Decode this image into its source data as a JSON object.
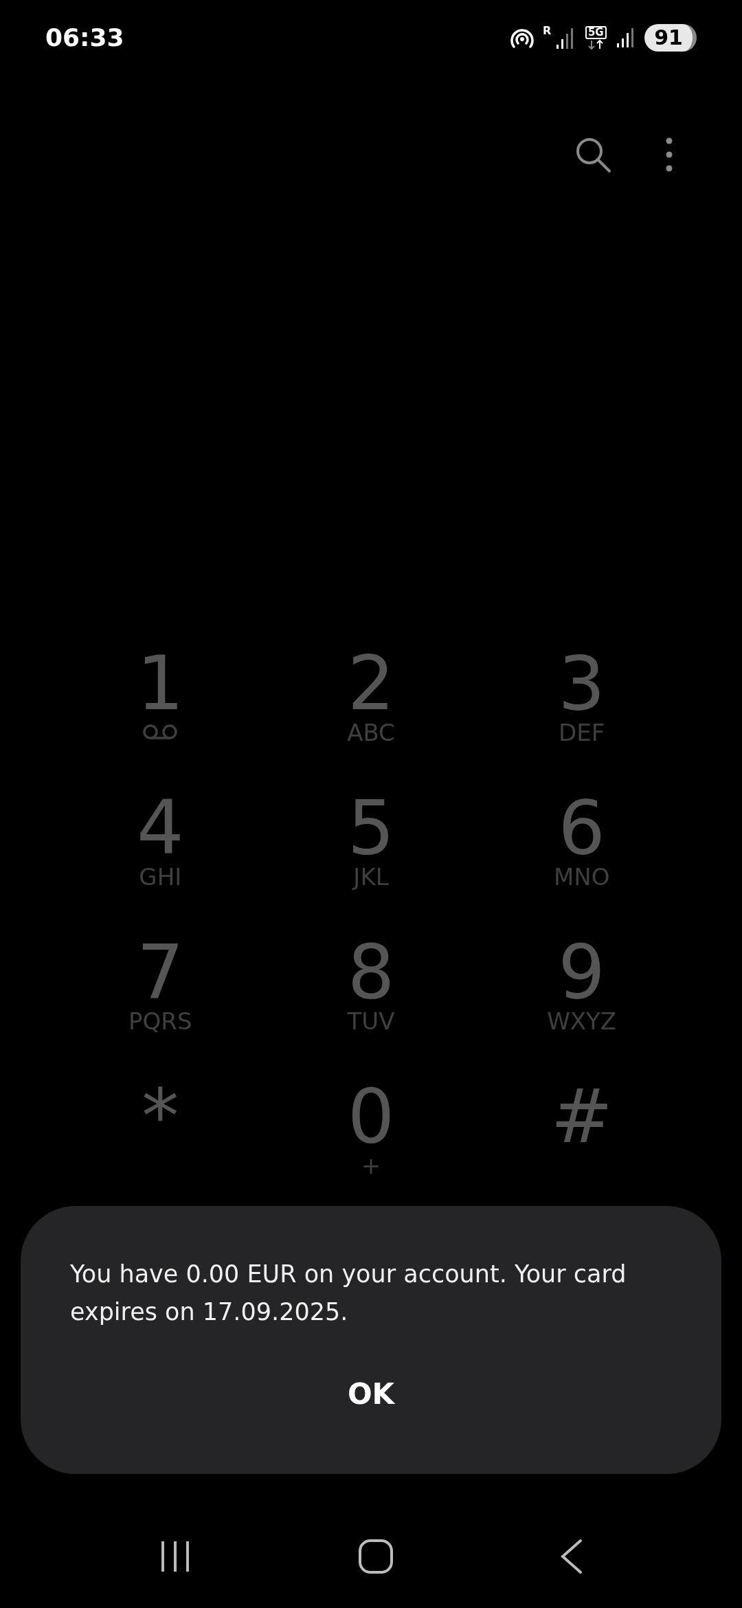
{
  "status_bar": {
    "time": "06:33",
    "roaming": "R",
    "network": "5G",
    "battery": "91"
  },
  "keys": [
    {
      "digit": "1",
      "kind": "voicemail"
    },
    {
      "digit": "2",
      "kind": "letters",
      "letters": "ABC"
    },
    {
      "digit": "3",
      "kind": "letters",
      "letters": "DEF"
    },
    {
      "digit": "4",
      "kind": "letters",
      "letters": "GHI"
    },
    {
      "digit": "5",
      "kind": "letters",
      "letters": "JKL"
    },
    {
      "digit": "6",
      "kind": "letters",
      "letters": "MNO"
    },
    {
      "digit": "7",
      "kind": "letters",
      "letters": "PQRS"
    },
    {
      "digit": "8",
      "kind": "letters",
      "letters": "TUV"
    },
    {
      "digit": "9",
      "kind": "letters",
      "letters": "WXYZ"
    },
    {
      "digit": "*",
      "kind": "plain"
    },
    {
      "digit": "0",
      "kind": "letters",
      "letters": "+"
    },
    {
      "digit": "#",
      "kind": "plain"
    }
  ],
  "dialog": {
    "message": "You have 0.00 EUR on your account. Your card expires on 17.09.2025.",
    "button": "OK"
  }
}
